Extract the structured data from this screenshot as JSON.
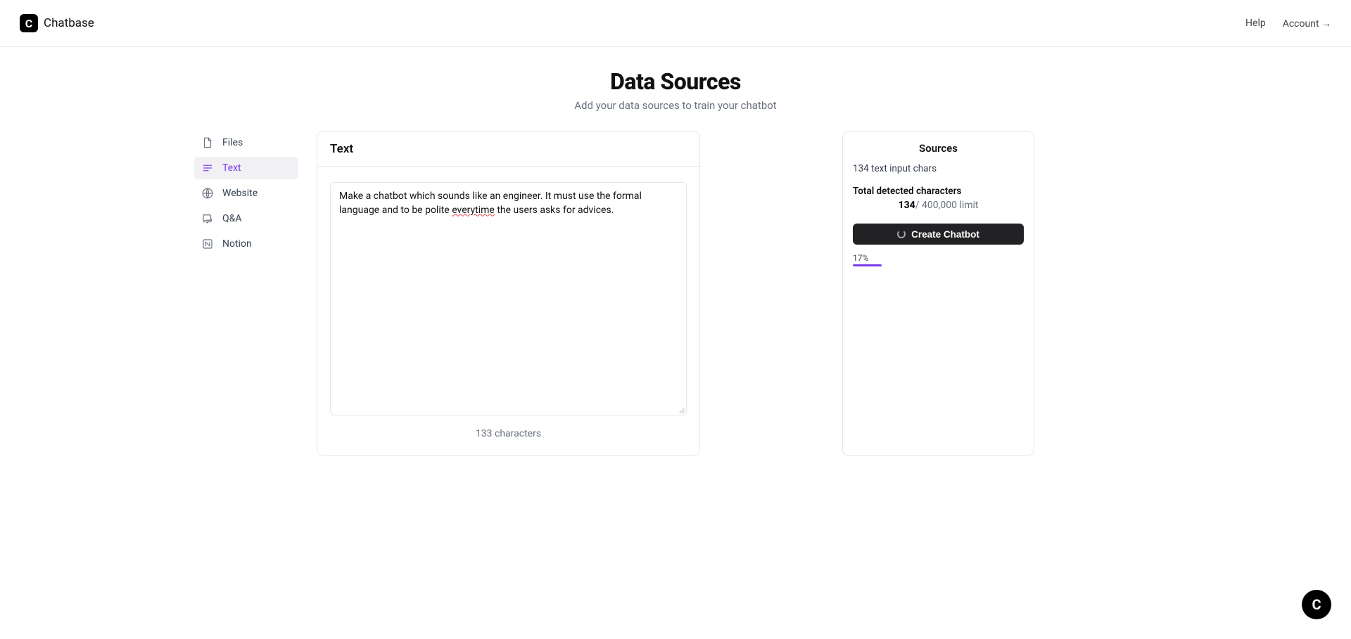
{
  "brand": {
    "logo_letter": "C",
    "name": "Chatbase"
  },
  "nav": {
    "help": "Help",
    "account": "Account →"
  },
  "page": {
    "title": "Data Sources",
    "subtitle": "Add your data sources to train your chatbot"
  },
  "sidebar": {
    "items": [
      {
        "id": "files",
        "label": "Files"
      },
      {
        "id": "text",
        "label": "Text"
      },
      {
        "id": "website",
        "label": "Website"
      },
      {
        "id": "qa",
        "label": "Q&A"
      },
      {
        "id": "notion",
        "label": "Notion"
      }
    ],
    "active_id": "text"
  },
  "text_panel": {
    "heading": "Text",
    "value_part1": "Make a chatbot which sounds like an engineer. It must use the formal language and to be polite ",
    "value_misspelled": "everytime",
    "value_part2": " the users asks for advices.",
    "char_count_text": "133 characters"
  },
  "sources_panel": {
    "heading": "Sources",
    "input_chars_line": "134 text input chars",
    "total_label": "Total detected characters",
    "count": "134",
    "limit_text": "/ 400,000 limit",
    "button_label": "Create Chatbot",
    "progress_label": "17%",
    "progress_percent": 17
  },
  "fab_letter": "C"
}
